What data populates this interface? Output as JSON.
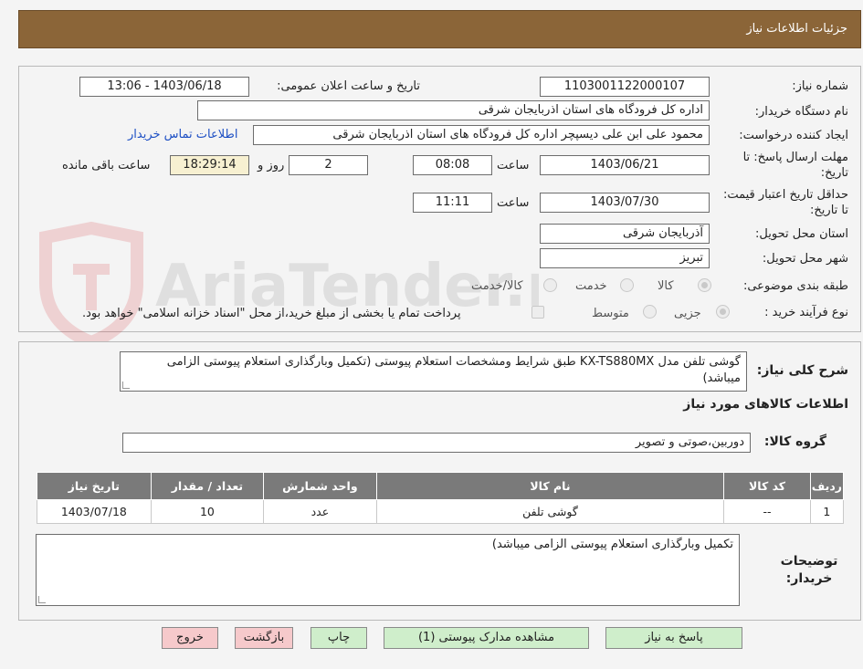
{
  "header": {
    "title": "جزئیات اطلاعات نیاز"
  },
  "watermark": {
    "text": "AriaTender.net"
  },
  "info": {
    "need_number_label": "شماره نیاز:",
    "need_number": "1103001122000107",
    "announce_label": "تاریخ و ساعت اعلان عمومی:",
    "announce_value": "1403/06/18 - 13:06",
    "buyer_org_label": "نام دستگاه خریدار:",
    "buyer_org": "اداره کل فرودگاه های استان اذربایجان شرقی",
    "creator_label": "ایجاد کننده درخواست:",
    "creator": "محمود علی ابن علی دیسپچر اداره کل فرودگاه های استان اذربایجان شرقی",
    "contact_link": "اطلاعات تماس خریدار",
    "deadline_label": "مهلت ارسال پاسخ: تا تاریخ:",
    "deadline_date": "1403/06/21",
    "time_label": "ساعت",
    "deadline_time": "08:08",
    "days_value": "2",
    "days_label": "روز و",
    "remaining_time": "18:29:14",
    "remaining_label": "ساعت باقی مانده",
    "validity_label": "حداقل تاریخ اعتبار قیمت: تا تاریخ:",
    "validity_date": "1403/07/30",
    "validity_time_label": "ساعت",
    "validity_time": "11:11",
    "province_label": "استان محل تحویل:",
    "province": "آذربایجان شرقی",
    "city_label": "شهر محل تحویل:",
    "city": "تبریز",
    "category_label": "طبقه بندی موضوعی:",
    "category_options": [
      "کالا",
      "خدمت",
      "کالا/خدمت"
    ],
    "process_label": "نوع فرآیند خرید :",
    "process_options": [
      "جزیی",
      "متوسط"
    ],
    "payment_note": "پرداخت تمام یا بخشی از مبلغ خرید،از محل \"اسناد خزانه اسلامی\" خواهد بود."
  },
  "summary": {
    "label": "شرح کلی نیاز:",
    "text": "گوشی تلفن مدل  KX-TS880MX طبق شرایط ومشخصات استعلام پیوستی (تکمیل وبارگذاری استعلام پیوستی الزامی میباشد)"
  },
  "goods": {
    "section_title": "اطلاعات کالاهای مورد نیاز",
    "group_label": "گروه کالا:",
    "group_value": "دوربین،صوتی و تصویر",
    "columns": [
      "ردیف",
      "کد کالا",
      "نام کالا",
      "واحد شمارش",
      "تعداد / مقدار",
      "تاریخ نیاز"
    ],
    "rows": [
      {
        "row": "1",
        "code": "--",
        "name": "گوشی تلفن",
        "unit": "عدد",
        "qty": "10",
        "date": "1403/07/18"
      }
    ]
  },
  "notes": {
    "label": "توضیحات خریدار:",
    "text": "تکمیل وبارگذاری استعلام پیوستی الزامی میباشد)"
  },
  "buttons": {
    "reply": "پاسخ به نیاز",
    "attachments": "مشاهده مدارک پیوستی (1)",
    "print": "چاپ",
    "back": "بازگشت",
    "exit": "خروج"
  }
}
